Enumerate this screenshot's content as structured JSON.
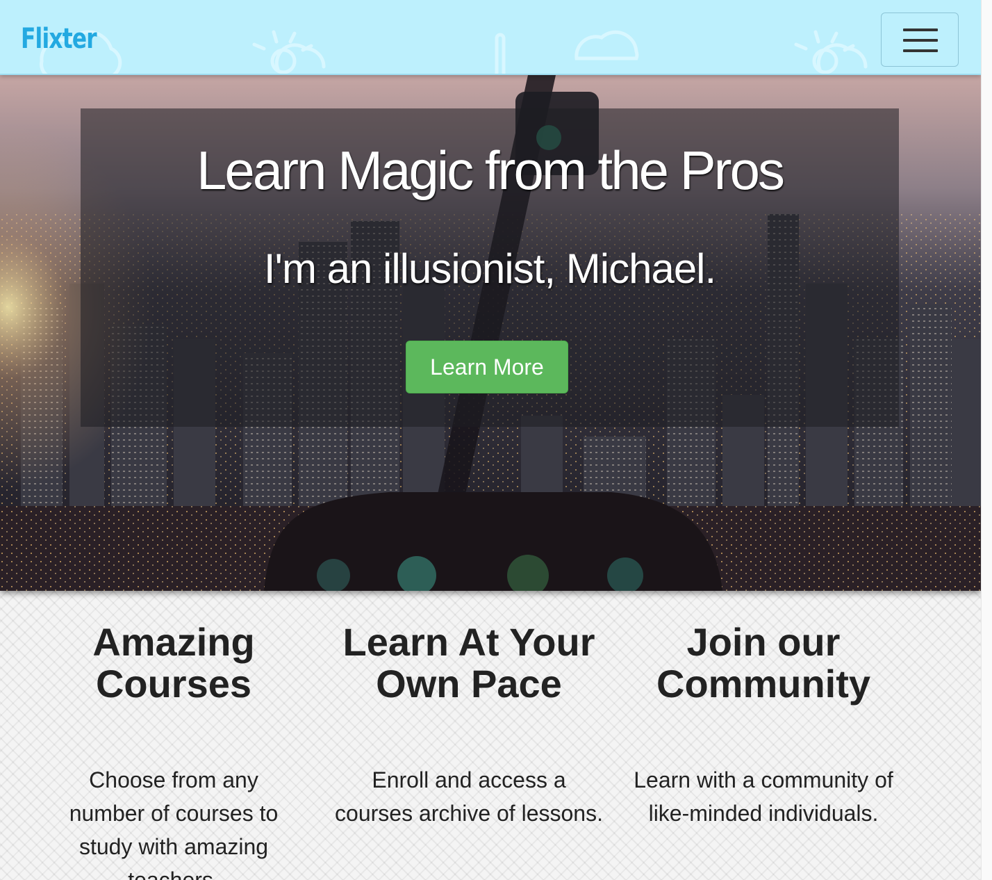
{
  "navbar": {
    "brand": "Flixter",
    "menu_toggle": "hamburger-icon"
  },
  "hero": {
    "title": "Learn Magic from the Pros",
    "subtitle": "I'm an illusionist, Michael.",
    "cta_label": "Learn More"
  },
  "features": [
    {
      "heading_line1": "Amazing",
      "heading_line2": "Courses",
      "body": "Choose from any number of courses to study with amazing teachers."
    },
    {
      "heading_line1": "Learn At Your",
      "heading_line2": "Own Pace",
      "body": "Enroll and access a courses archive of lessons."
    },
    {
      "heading_line1": "Join our",
      "heading_line2": "Community",
      "body": "Learn with a community of like-minded individuals."
    }
  ],
  "colors": {
    "navbar_bg": "#bdf0fd",
    "brand": "#23a9e1",
    "cta": "#5cb85c"
  }
}
